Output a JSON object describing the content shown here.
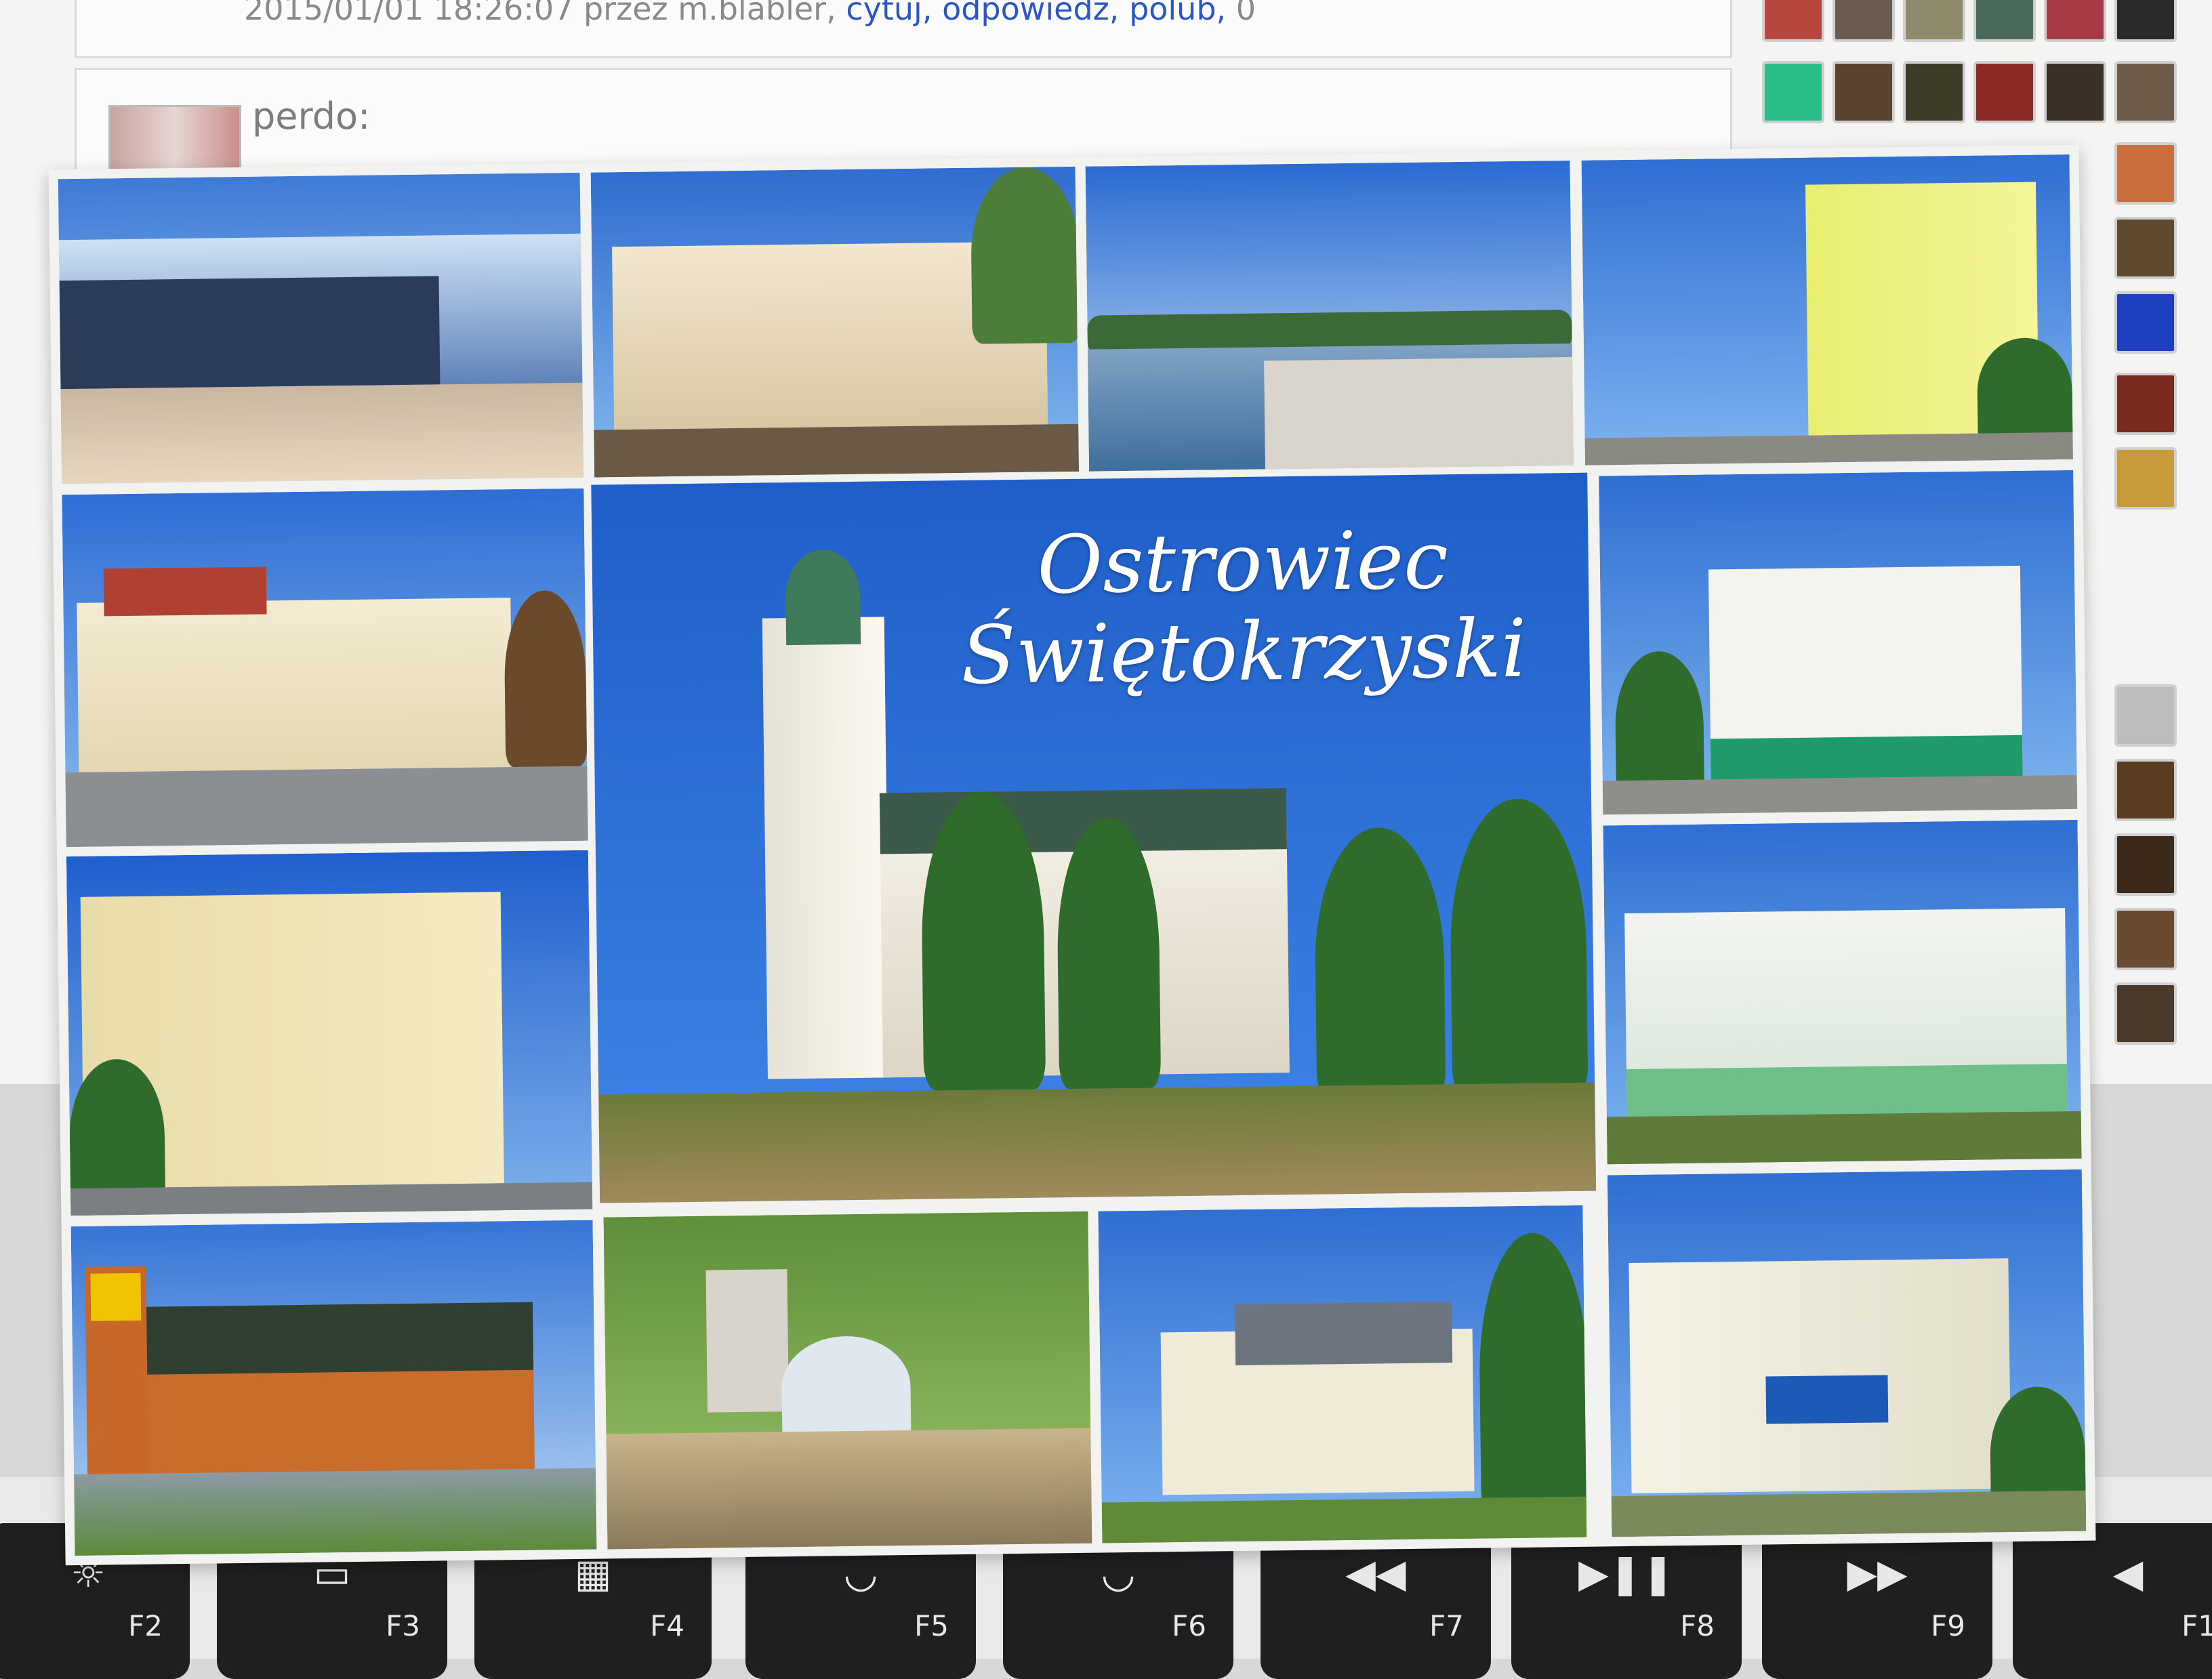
{
  "screen": {
    "comment_meta_prefix": "2015/01/01 18:26:07 przez m.blabler,",
    "comment_actions": [
      "cytuj,",
      "odpowiedz,",
      "polub,"
    ],
    "comment_likes": "0",
    "comment_author": "perdo:"
  },
  "postcard": {
    "title_line1": "Ostrowiec",
    "title_line2": "Świętokrzyski"
  },
  "keyboard": {
    "keys": [
      {
        "label": "F2",
        "icon": "brightness-up-icon",
        "glyph": "☼"
      },
      {
        "label": "F3",
        "icon": "mission-control-icon",
        "glyph": "▭"
      },
      {
        "label": "F4",
        "icon": "launchpad-icon",
        "glyph": "▦"
      },
      {
        "label": "F5",
        "icon": "keyboard-light-down-icon",
        "glyph": "◡"
      },
      {
        "label": "F6",
        "icon": "keyboard-light-up-icon",
        "glyph": "◡"
      },
      {
        "label": "F7",
        "icon": "rewind-icon",
        "glyph": "◀◀"
      },
      {
        "label": "F8",
        "icon": "play-pause-icon",
        "glyph": "▶❚❚"
      },
      {
        "label": "F9",
        "icon": "fast-forward-icon",
        "glyph": "▶▶"
      },
      {
        "label": "F1",
        "icon": "mute-icon",
        "glyph": "◀"
      }
    ]
  },
  "colors": {
    "postcard_blue": "#2a6fd8",
    "link_blue": "#2a56c6"
  }
}
